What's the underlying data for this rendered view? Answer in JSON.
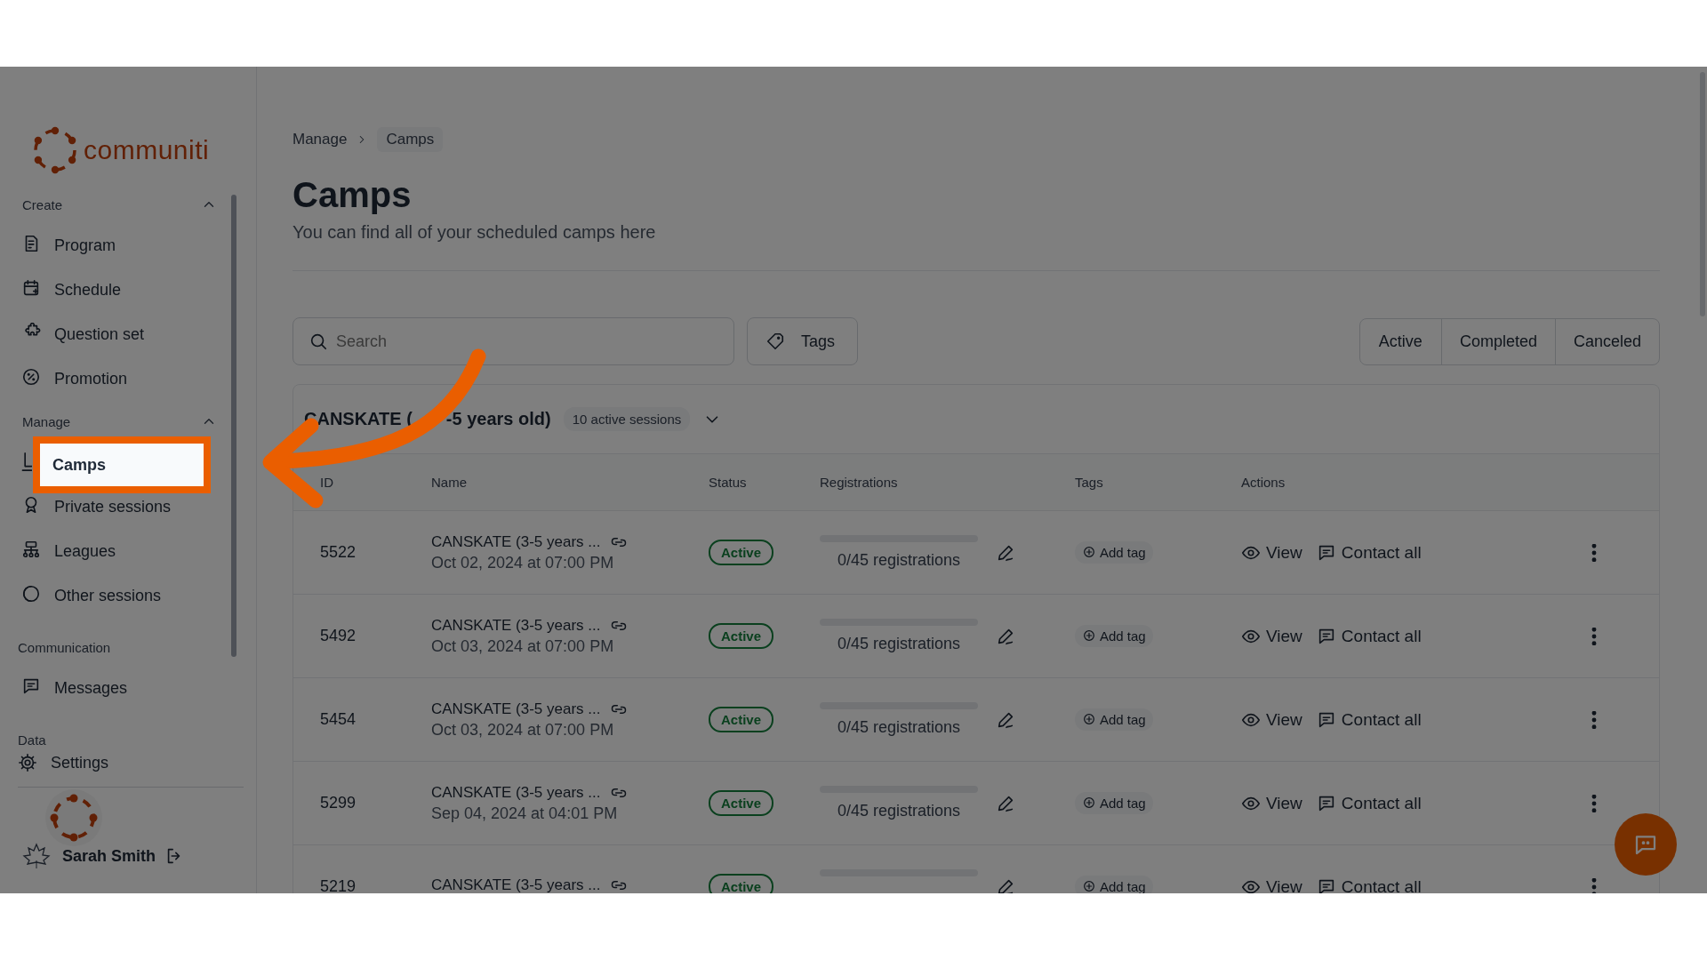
{
  "logo": {
    "text": "communiti"
  },
  "sidebar": {
    "sections": [
      {
        "title": "Create",
        "expanded": true,
        "items": [
          {
            "label": "Program",
            "selected": false
          },
          {
            "label": "Schedule",
            "selected": false
          },
          {
            "label": "Question set",
            "selected": false
          },
          {
            "label": "Promotion",
            "selected": false
          }
        ]
      },
      {
        "title": "Manage",
        "expanded": true,
        "items": [
          {
            "label": "Camps",
            "selected": true
          },
          {
            "label": "Private sessions",
            "selected": false
          },
          {
            "label": "Leagues",
            "selected": false
          },
          {
            "label": "Other sessions",
            "selected": false
          }
        ]
      },
      {
        "title": "Communication",
        "items": [
          {
            "label": "Messages",
            "selected": false
          }
        ]
      },
      {
        "title": "Data"
      }
    ],
    "settings": {
      "label": "Settings"
    },
    "user": {
      "name": "Sarah Smith"
    }
  },
  "breadcrumb": [
    {
      "label": "Manage"
    },
    {
      "label": "Camps"
    }
  ],
  "page": {
    "title": "Camps",
    "subtitle": "You can find all of your scheduled camps here"
  },
  "search": {
    "placeholder": "Search"
  },
  "tags_button": {
    "label": "Tags"
  },
  "status_filters": [
    {
      "label": "Active",
      "selected": false
    },
    {
      "label": "Completed",
      "selected": false
    },
    {
      "label": "Canceled",
      "selected": false
    }
  ],
  "group": {
    "title_start": "CANSKATE (",
    "title_end": "-5 years old)",
    "badge": "10 active sessions"
  },
  "table": {
    "columns": [
      "ID",
      "Name",
      "Status",
      "Registrations",
      "Tags",
      "Actions"
    ],
    "rows": [
      {
        "id": "5522",
        "name": "CANSKATE (3-5 years ...",
        "date": "Oct 02, 2024 at 07:00 PM",
        "status": "Active",
        "level": 0,
        "registrations": "0/45 registrations",
        "tag": "Add tag",
        "view": "View",
        "contact": "Contact all"
      },
      {
        "id": "5492",
        "name": "CANSKATE (3-5 years ...",
        "date": "Oct 03, 2024 at 07:00 PM",
        "status": "Active",
        "level": 0,
        "registrations": "0/45 registrations",
        "tag": "Add tag",
        "view": "View",
        "contact": "Contact all"
      },
      {
        "id": "5454",
        "name": "CANSKATE (3-5 years ...",
        "date": "Oct 03, 2024 at 07:00 PM",
        "status": "Active",
        "level": 0,
        "registrations": "0/45 registrations",
        "tag": "Add tag",
        "view": "View",
        "contact": "Contact all"
      },
      {
        "id": "5299",
        "name": "CANSKATE (3-5 years ...",
        "date": "Sep 04, 2024 at 04:01 PM",
        "status": "Active",
        "level": 0,
        "registrations": "0/45 registrations",
        "tag": "Add tag",
        "view": "View",
        "contact": "Contact all"
      },
      {
        "id": "5219",
        "name": "CANSKATE (3-5 years ...",
        "status": "Active",
        "level": 0,
        "tag": "Add tag",
        "view": "View",
        "contact": "Contact all"
      }
    ]
  }
}
